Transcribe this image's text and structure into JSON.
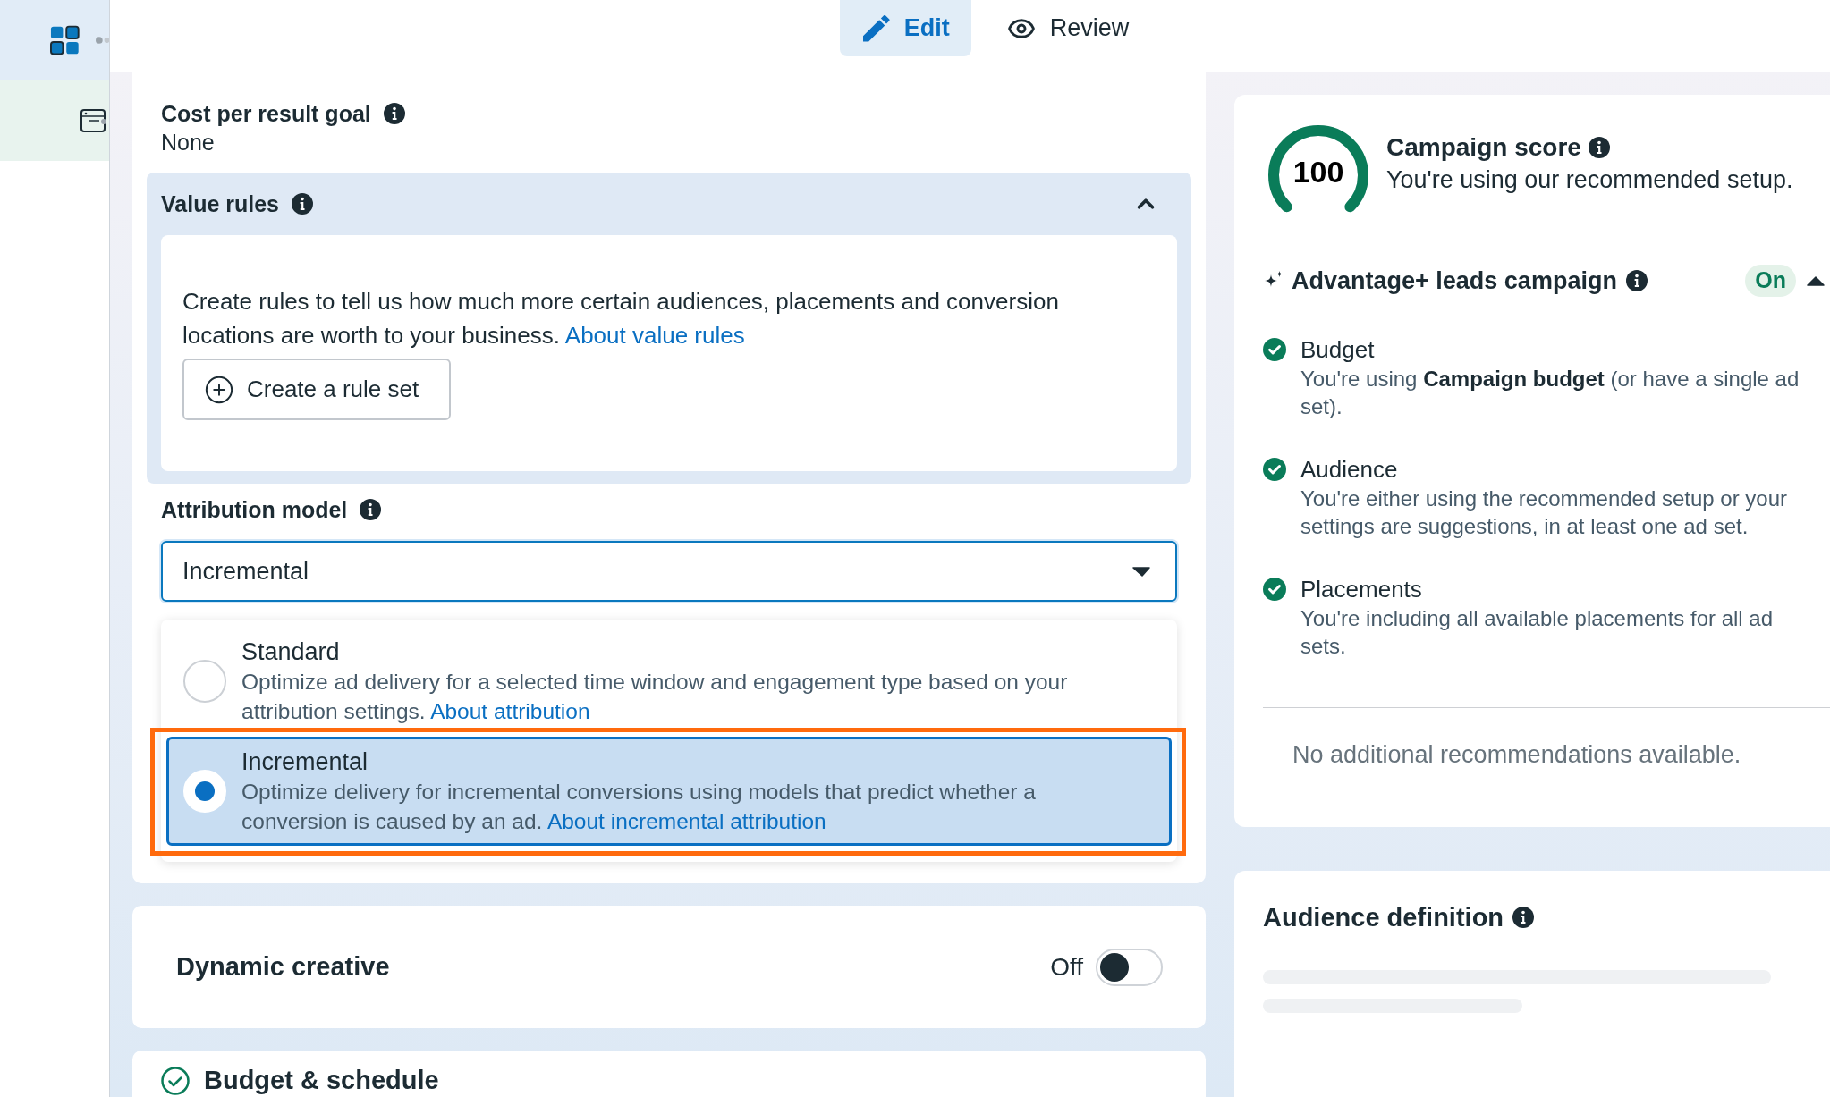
{
  "tabs": [
    {
      "label": "Edit",
      "selected": true
    },
    {
      "label": "Review",
      "selected": false
    }
  ],
  "cost_per_result_goal": {
    "label": "Cost per result goal",
    "value": "None"
  },
  "value_rules": {
    "title": "Value rules",
    "expanded": true,
    "description": "Create rules to tell us how much more certain audiences, placements and conversion locations are worth to your business.",
    "link": "About value rules",
    "button": "Create a rule set"
  },
  "attribution_model": {
    "label": "Attribution model",
    "select": {
      "value": "Incremental",
      "open": true
    },
    "options": [
      {
        "title": "Standard",
        "description": "Optimize ad delivery for a selected time window and engagement type based on your attribution settings.",
        "link": "About attribution",
        "selected": false,
        "highlighted": false
      },
      {
        "title": "Incremental",
        "description": "Optimize delivery for incremental conversions using models that predict whether a conversion is caused by an ad.",
        "link": "About incremental attribution",
        "selected": true,
        "highlighted": true
      }
    ]
  },
  "dynamic_creative": {
    "title": "Dynamic creative",
    "state_label": "Off",
    "on": false
  },
  "budget_schedule": {
    "title": "Budget & schedule",
    "completed": true
  },
  "campaign_score": {
    "score": "100",
    "level": 1,
    "title": "Campaign score",
    "subtitle": "You're using our recommended setup."
  },
  "advantage_plus": {
    "title": "Advantage+ leads campaign",
    "badge": "On",
    "on": true,
    "expanded": true,
    "items": [
      {
        "title": "Budget",
        "description": "You're using **Campaign budget** (or have a single ad set).",
        "done": true
      },
      {
        "title": "Audience",
        "description": "You're either using the recommended setup or your settings are suggestions, in at least one ad set.",
        "done": true
      },
      {
        "title": "Placements",
        "description": "You're including all available placements for all ad sets.",
        "done": true
      }
    ],
    "note": "No additional recommendations available."
  },
  "audience_definition": {
    "title": "Audience definition",
    "loading": true
  }
}
